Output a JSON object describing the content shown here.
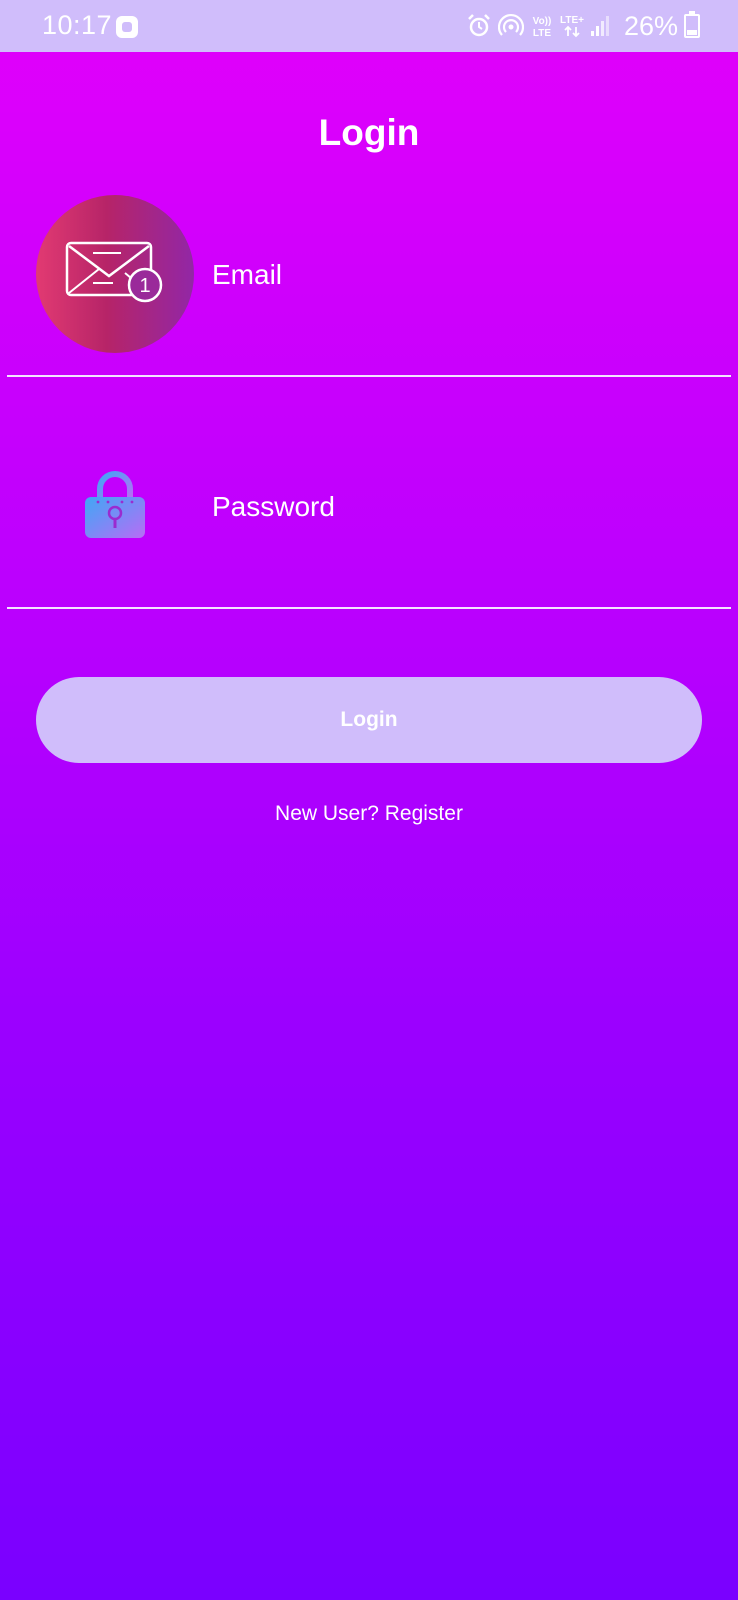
{
  "status_bar": {
    "time": "10:17",
    "network_vo": "Vo))",
    "network_lte": "LTE",
    "network_lte_plus": "LTE+",
    "battery": "26%",
    "icons": [
      "app-notification-icon",
      "alarm-icon",
      "hotspot-icon",
      "volte-icon",
      "lte-data-icon",
      "signal-icon",
      "battery-icon"
    ]
  },
  "page": {
    "title": "Login"
  },
  "form": {
    "email_label": "Email",
    "email_icon": "mail-notification-icon",
    "email_badge": "1",
    "password_label": "Password",
    "password_icon": "lock-icon",
    "login_button": "Login",
    "register_link": "New User? Register"
  },
  "colors": {
    "status_bar_bg": "#d0bdfb",
    "gradient_top": "#e200fb",
    "gradient_bottom": "#7a00ff",
    "button_bg": "#d0bdfb",
    "text": "#ffffff"
  }
}
